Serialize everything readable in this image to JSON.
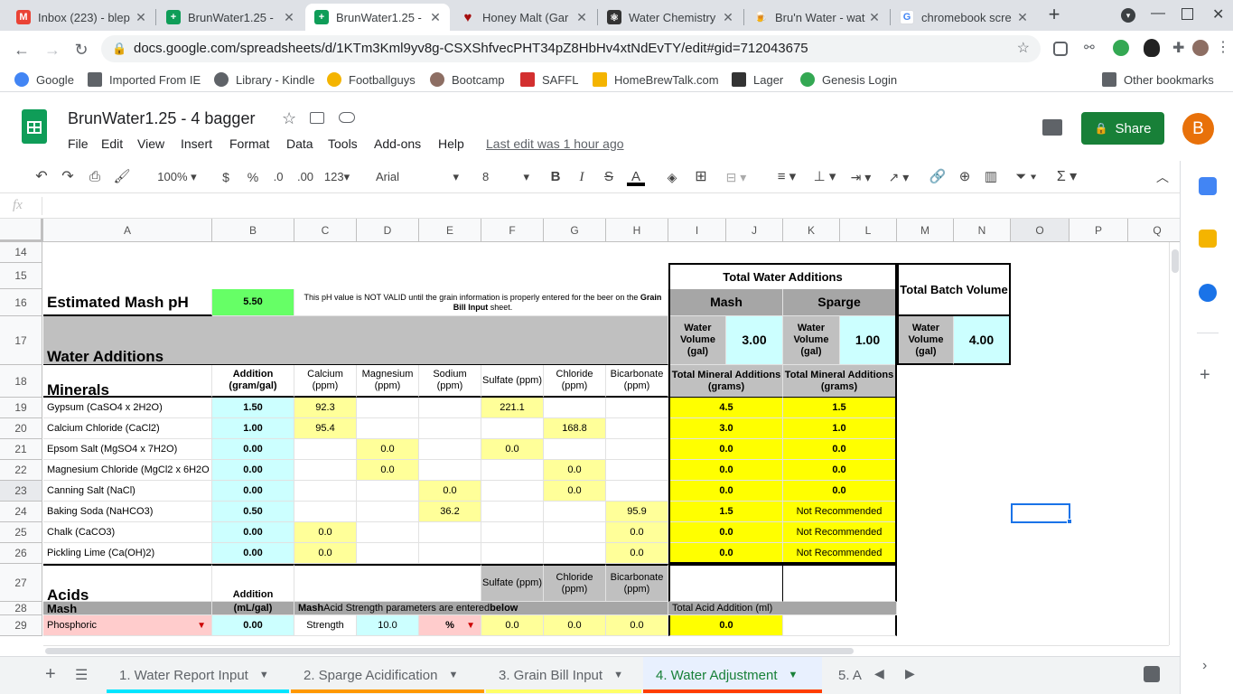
{
  "browser": {
    "tabs": [
      {
        "title": "Inbox (223) - blep",
        "color": "#ea4335",
        "glyph": "M"
      },
      {
        "title": "BrunWater1.25 -",
        "color": "#0f9d58",
        "glyph": "+"
      },
      {
        "title": "BrunWater1.25 -",
        "color": "#0f9d58",
        "glyph": "+"
      },
      {
        "title": "Honey Malt (Gar",
        "color": "#a50e0e",
        "glyph": "♥"
      },
      {
        "title": "Water Chemistry",
        "color": "#333333",
        "glyph": "⚛"
      },
      {
        "title": "Bru'n Water - wat",
        "color": "#f4b400",
        "glyph": "🍺"
      },
      {
        "title": "chromebook scre",
        "color": "#4285f4",
        "glyph": "G"
      }
    ],
    "new_tab": "+",
    "url": "docs.google.com/spreadsheets/d/1KTm3Kml9yv8g-CSXShfvecPHT34pZ8HbHv4xtNdEvTY/edit#gid=712043675",
    "bookmarks": [
      {
        "label": "Google",
        "color": "#4285f4"
      },
      {
        "label": "Imported From IE",
        "color": "#5f6368"
      },
      {
        "label": "Library - Kindle",
        "color": "#5f6368"
      },
      {
        "label": "Footballguys",
        "color": "#f4b400"
      },
      {
        "label": "Bootcamp",
        "color": "#8d6e63"
      },
      {
        "label": "SAFFL",
        "color": "#d32f2f"
      },
      {
        "label": "HomeBrewTalk.com",
        "color": "#f4b400"
      },
      {
        "label": "Lager",
        "color": "#333333"
      },
      {
        "label": "Genesis Login",
        "color": "#34a853"
      }
    ],
    "other_bookmarks": "Other bookmarks"
  },
  "sheets": {
    "doc_title": "BrunWater1.25 - 4 bagger",
    "menus": [
      "File",
      "Edit",
      "View",
      "Insert",
      "Format",
      "Data",
      "Tools",
      "Add-ons",
      "Help"
    ],
    "last_edit": "Last edit was 1 hour ago",
    "share_label": "Share",
    "avatar_letter": "B",
    "toolbar": {
      "zoom": "100%",
      "currency": "$",
      "percent": "%",
      "dec_less": ".0",
      "dec_more": ".00",
      "format_more": "123",
      "font": "Arial",
      "font_size": "8"
    },
    "fx": "fx",
    "columns": [
      "A",
      "B",
      "C",
      "D",
      "E",
      "F",
      "G",
      "H",
      "I",
      "J",
      "K",
      "L",
      "M",
      "N",
      "O",
      "P",
      "Q"
    ],
    "rows": [
      "14",
      "15",
      "16",
      "17",
      "18",
      "19",
      "20",
      "21",
      "22",
      "23",
      "24",
      "25",
      "26",
      "27",
      "28",
      "29"
    ]
  },
  "sheet_cells": {
    "total_water_additions": "Total Water Additions",
    "total_batch_volume": "Total Batch Volume",
    "mash": "Mash",
    "sparge": "Sparge",
    "estimated_mash_ph_label": "Estimated Mash pH",
    "estimated_mash_ph_value": "5.50",
    "ph_note_1": "This pH value is NOT VALID until the grain information is properly entered for the beer on the",
    "ph_note_bold": "Grain Bill Input",
    "ph_note_2": " sheet.",
    "water_additions": "Water Additions",
    "water_volume_label": "Water Volume (gal)",
    "mash_volume": "3.00",
    "sparge_volume": "1.00",
    "total_volume": "4.00",
    "minerals": "Minerals",
    "headers": [
      "Addition (gram/gal)",
      "Calcium (ppm)",
      "Magnesium (ppm)",
      "Sodium (ppm)",
      "Sulfate (ppm)",
      "Chloride (ppm)",
      "Bicarbonate (ppm)",
      "Total Mineral Additions (grams)",
      "Total Mineral Additions (grams)"
    ],
    "mineral_rows": [
      {
        "name": "Gypsum (CaSO4 x 2H2O)",
        "add": "1.50",
        "ca": "92.3",
        "mg": "",
        "na": "",
        "so4": "221.1",
        "cl": "",
        "hco3": "",
        "mash": "4.5",
        "sparge": "1.5"
      },
      {
        "name": "Calcium Chloride (CaCl2)",
        "add": "1.00",
        "ca": "95.4",
        "mg": "",
        "na": "",
        "so4": "",
        "cl": "168.8",
        "hco3": "",
        "mash": "3.0",
        "sparge": "1.0"
      },
      {
        "name": "Epsom Salt (MgSO4 x 7H2O)",
        "add": "0.00",
        "ca": "",
        "mg": "0.0",
        "na": "",
        "so4": "0.0",
        "cl": "",
        "hco3": "",
        "mash": "0.0",
        "sparge": "0.0"
      },
      {
        "name": "Magnesium Chloride (MgCl2 x 6H2O",
        "add": "0.00",
        "ca": "",
        "mg": "0.0",
        "na": "",
        "so4": "",
        "cl": "0.0",
        "hco3": "",
        "mash": "0.0",
        "sparge": "0.0"
      },
      {
        "name": "Canning Salt (NaCl)",
        "add": "0.00",
        "ca": "",
        "mg": "",
        "na": "0.0",
        "so4": "",
        "cl": "0.0",
        "hco3": "",
        "mash": "0.0",
        "sparge": "0.0"
      },
      {
        "name": "Baking Soda (NaHCO3)",
        "add": "0.50",
        "ca": "",
        "mg": "",
        "na": "36.2",
        "so4": "",
        "cl": "",
        "hco3": "95.9",
        "mash": "1.5",
        "sparge": "Not Recommended"
      },
      {
        "name": "Chalk (CaCO3)",
        "add": "0.00",
        "ca": "0.0",
        "mg": "",
        "na": "",
        "so4": "",
        "cl": "",
        "hco3": "0.0",
        "mash": "0.0",
        "sparge": "Not Recommended"
      },
      {
        "name": "Pickling Lime (Ca(OH)2)",
        "add": "0.00",
        "ca": "0.0",
        "mg": "",
        "na": "",
        "so4": "",
        "cl": "",
        "hco3": "0.0",
        "mash": "0.0",
        "sparge": "Not Recommended"
      }
    ],
    "acids": "Acids",
    "acid_addition": "Addition",
    "acid_sulfate": "Sulfate (ppm)",
    "acid_chloride": "Chloride (ppm)",
    "acid_bicarbonate": "Bicarbonate (ppm)",
    "mash_label": "Mash",
    "ml_gal": "(mL/gal)",
    "mash_acid_note_1": "Mash",
    "mash_acid_note_2": " Acid Strength parameters are entered ",
    "mash_acid_note_3": "below",
    "total_acid_addition": "Total Acid Addition (ml)",
    "acid_name": "Phosphoric",
    "acid_add": "0.00",
    "strength_label": "Strength",
    "strength_value": "10.0",
    "strength_unit": "%",
    "acid_so4": "0.0",
    "acid_cl": "0.0",
    "acid_hco3": "0.0",
    "acid_total": "0.0"
  },
  "sheet_tabs": [
    {
      "label": "1. Water Report Input",
      "color": "#00e5ff"
    },
    {
      "label": "2. Sparge Acidification",
      "color": "#ff9800"
    },
    {
      "label": "3. Grain Bill Input",
      "color": "#ffff66"
    },
    {
      "label": "4. Water Adjustment",
      "color": "#ff3d00"
    },
    {
      "label": "5. A",
      "color": "#9e9e9e"
    }
  ]
}
